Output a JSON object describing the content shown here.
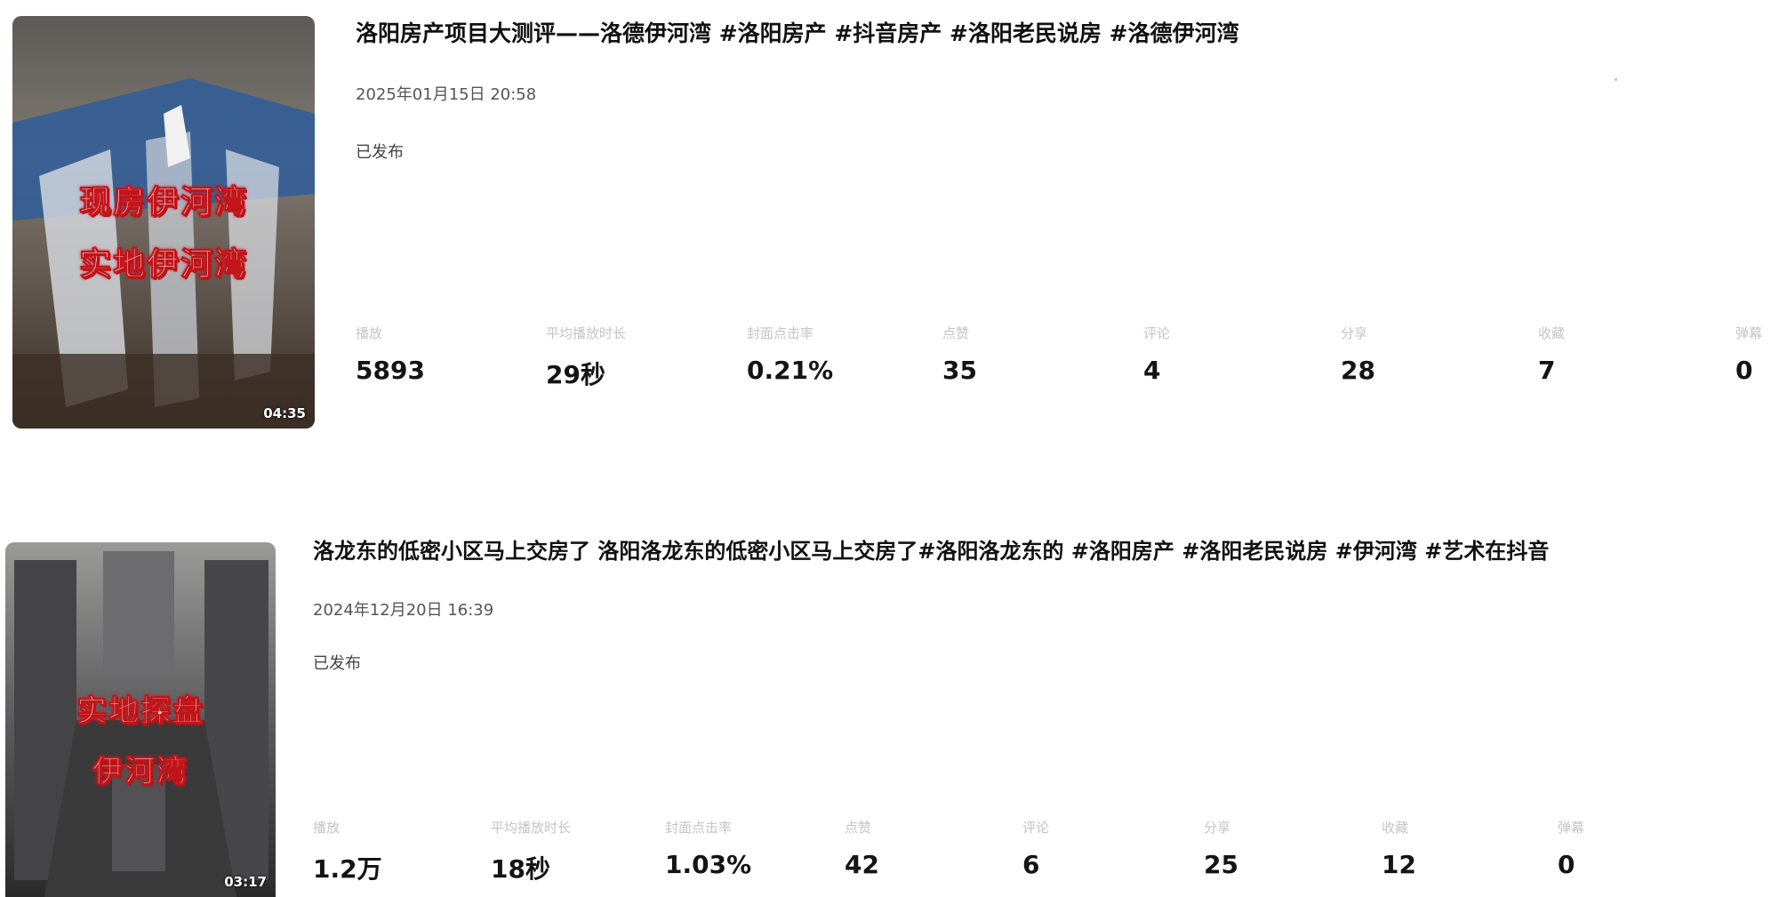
{
  "videos": [
    {
      "thumbnail": {
        "overlay_lines": [
          "现房伊河湾",
          "实地伊河湾"
        ],
        "duration": "04:35",
        "colors": {
          "sky": "#6d6a66",
          "glass": "#2f5d9a",
          "ground": "#3b2e25"
        }
      },
      "title": "洛阳房产项目大测评——洛德伊河湾 #洛阳房产 #抖音房产 #洛阳老民说房 #洛德伊河湾",
      "date": "2025年01月15日 20:58",
      "status": "已发布",
      "metrics": [
        {
          "label": "播放",
          "value": "5893"
        },
        {
          "label": "平均播放时长",
          "value": "29秒"
        },
        {
          "label": "封面点击率",
          "value": "0.21%"
        },
        {
          "label": "点赞",
          "value": "35"
        },
        {
          "label": "评论",
          "value": "4"
        },
        {
          "label": "分享",
          "value": "28"
        },
        {
          "label": "收藏",
          "value": "7"
        },
        {
          "label": "弹幕",
          "value": "0"
        }
      ]
    },
    {
      "thumbnail": {
        "overlay_lines": [
          "实地探盘",
          "伊河湾"
        ],
        "duration": "03:17",
        "colors": {
          "sky": "#8a8a88",
          "glass": "#5a5a5c",
          "ground": "#2c2c2c"
        }
      },
      "title": "洛龙东的低密小区马上交房了 洛阳洛龙东的低密小区马上交房了#洛阳洛龙东的 #洛阳房产 #洛阳老民说房 #伊河湾 #艺术在抖音",
      "date": "2024年12月20日 16:39",
      "status": "已发布",
      "metrics": [
        {
          "label": "播放",
          "value": "1.2万"
        },
        {
          "label": "平均播放时长",
          "value": "18秒"
        },
        {
          "label": "封面点击率",
          "value": "1.03%"
        },
        {
          "label": "点赞",
          "value": "42"
        },
        {
          "label": "评论",
          "value": "6"
        },
        {
          "label": "分享",
          "value": "25"
        },
        {
          "label": "收藏",
          "value": "12"
        },
        {
          "label": "弹幕",
          "value": "0"
        }
      ]
    }
  ]
}
